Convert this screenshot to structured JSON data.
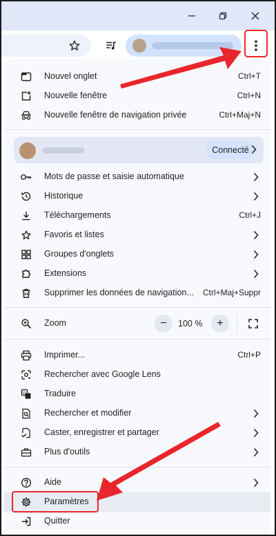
{
  "menu": {
    "items_top": [
      {
        "label": "Nouvel onglet",
        "shortcut": "Ctrl+T",
        "icon": "new-tab-icon"
      },
      {
        "label": "Nouvelle fenêtre",
        "shortcut": "Ctrl+N",
        "icon": "new-window-icon"
      },
      {
        "label": "Nouvelle fenêtre de navigation privée",
        "shortcut": "Ctrl+Maj+N",
        "icon": "incognito-icon"
      }
    ],
    "profile": {
      "status": "Connecté",
      "icon": "avatar"
    },
    "items_mid": [
      {
        "label": "Mots de passe et saisie automatique",
        "icon": "key-icon"
      },
      {
        "label": "Historique",
        "icon": "history-icon"
      },
      {
        "label": "Téléchargements",
        "shortcut": "Ctrl+J",
        "icon": "download-icon"
      },
      {
        "label": "Favoris et listes",
        "icon": "star-icon"
      },
      {
        "label": "Groupes d'onglets",
        "icon": "tab-groups-icon"
      },
      {
        "label": "Extensions",
        "icon": "puzzle-icon"
      },
      {
        "label": "Supprimer les données de navigation...",
        "shortcut": "Ctrl+Maj+Suppr",
        "icon": "trash-icon"
      }
    ],
    "zoom": {
      "label": "Zoom",
      "value": "100 %",
      "minus": "−",
      "plus": "+",
      "icon": "zoom-icon"
    },
    "items_tools": [
      {
        "label": "Imprimer...",
        "shortcut": "Ctrl+P",
        "icon": "printer-icon"
      },
      {
        "label": "Rechercher avec Google Lens",
        "icon": "lens-icon"
      },
      {
        "label": "Traduire",
        "icon": "translate-icon"
      },
      {
        "label": "Rechercher et modifier",
        "icon": "find-icon"
      },
      {
        "label": "Caster, enregistrer et partager",
        "icon": "cast-icon"
      },
      {
        "label": "Plus d'outils",
        "icon": "toolbox-icon"
      }
    ],
    "items_bottom": [
      {
        "label": "Aide",
        "icon": "help-icon"
      },
      {
        "label": "Paramètres",
        "icon": "gear-icon"
      },
      {
        "label": "Quitter",
        "icon": "exit-icon"
      }
    ]
  },
  "colors": {
    "highlight": "#e8262c",
    "menu_bg": "#f7f9fd",
    "chip": "#d3e3fd"
  }
}
